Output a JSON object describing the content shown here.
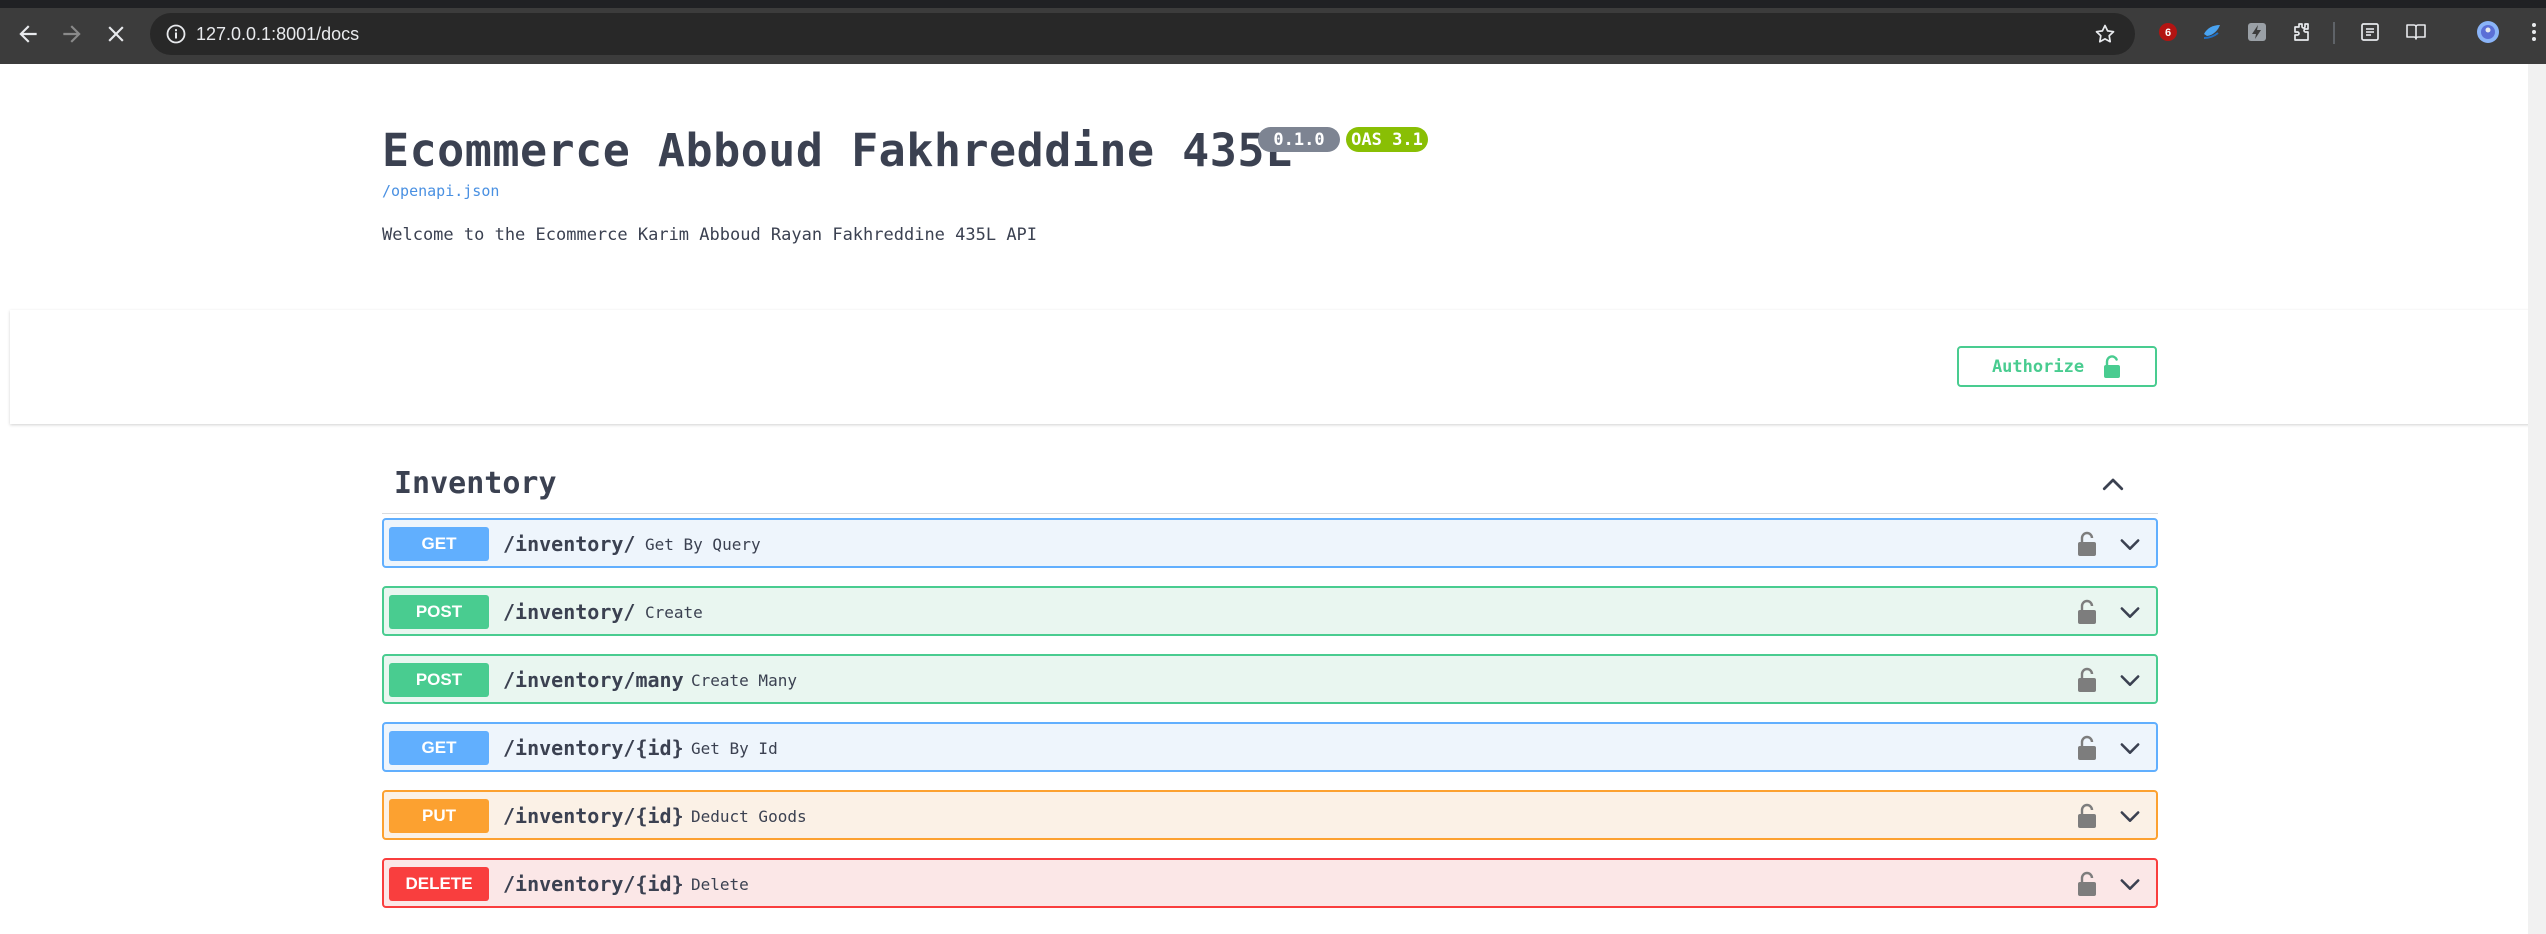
{
  "browser": {
    "url": "127.0.0.1:8001/docs",
    "extension_badge": "6"
  },
  "api": {
    "title": "Ecommerce Abboud Fakhreddine 435L",
    "version_badge": "0.1.0",
    "oas_badge": "OAS 3.1",
    "openapi_link": "/openapi.json",
    "description": "Welcome to the Ecommerce Karim Abboud Rayan Fakhreddine 435L API"
  },
  "authorize": {
    "label": "Authorize"
  },
  "tag": {
    "name": "Inventory"
  },
  "operations": [
    {
      "method": "GET",
      "path": "/inventory/",
      "summary": "Get By Query"
    },
    {
      "method": "POST",
      "path": "/inventory/",
      "summary": "Create"
    },
    {
      "method": "POST",
      "path": "/inventory/many",
      "summary": "Create Many"
    },
    {
      "method": "GET",
      "path": "/inventory/{id}",
      "summary": "Get By Id"
    },
    {
      "method": "PUT",
      "path": "/inventory/{id}",
      "summary": "Deduct Goods"
    },
    {
      "method": "DELETE",
      "path": "/inventory/{id}",
      "summary": "Delete"
    }
  ],
  "colors": {
    "get": "#61affe",
    "post": "#49cc90",
    "put": "#fca130",
    "delete": "#f93e3e",
    "text": "#3b4151"
  }
}
